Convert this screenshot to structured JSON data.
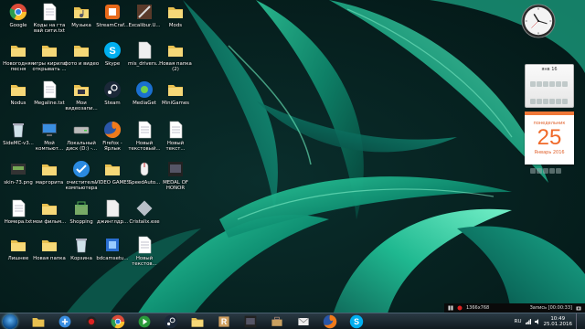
{
  "desktop": {
    "icons": [
      {
        "label": "Google",
        "icon": "chrome-icon"
      },
      {
        "label": "Коды на гта вай сити.txt",
        "icon": "text-file-icon"
      },
      {
        "label": "Музыка",
        "icon": "music-folder-icon"
      },
      {
        "label": "StreamCraf...",
        "icon": "streamcraft-icon"
      },
      {
        "label": "Excalibur.U...",
        "icon": "excalibur-icon"
      },
      {
        "label": "Mods",
        "icon": "folder-icon"
      },
      {
        "label": "Новогодняя песня",
        "icon": "folder-icon"
      },
      {
        "label": "игры кирила открывать ...",
        "icon": "folder-icon"
      },
      {
        "label": "фото и видео",
        "icon": "folder-icon"
      },
      {
        "label": "Skype",
        "icon": "skype-icon"
      },
      {
        "label": "mis_drivers...",
        "icon": "file-icon"
      },
      {
        "label": "Новая папка (2)",
        "icon": "folder-icon"
      },
      {
        "label": "Nodus",
        "icon": "folder-icon"
      },
      {
        "label": "Megaline.txt",
        "icon": "text-file-icon"
      },
      {
        "label": "Мои видеозапи...",
        "icon": "video-folder-icon"
      },
      {
        "label": "Steam",
        "icon": "steam-icon"
      },
      {
        "label": "MediaGet",
        "icon": "mediaget-icon"
      },
      {
        "label": "MiniGames",
        "icon": "folder-icon"
      },
      {
        "label": "SideMC-v3...",
        "icon": "recycle-bin-icon"
      },
      {
        "label": "Мой компьют...",
        "icon": "computer-icon"
      },
      {
        "label": "Локальный диск (D:) -...",
        "icon": "drive-icon"
      },
      {
        "label": "Firefox - Ярлык",
        "icon": "firefox-icon"
      },
      {
        "label": "Новый текстовый...",
        "icon": "text-file-icon"
      },
      {
        "label": "Новый текст...",
        "icon": "text-file-icon"
      },
      {
        "label": "skin-73.png",
        "icon": "image-file-icon"
      },
      {
        "label": "маргорита",
        "icon": "folder-icon"
      },
      {
        "label": "очиститель компьютера",
        "icon": "cleaner-icon"
      },
      {
        "label": "VIDEO GAMES",
        "icon": "folder-icon"
      },
      {
        "label": "SpeedAuto...",
        "icon": "mouse-icon"
      },
      {
        "label": "MEDAL OF HONOR",
        "icon": "game-icon"
      },
      {
        "label": "Номера.txt",
        "icon": "text-file-icon"
      },
      {
        "label": "мои фильм...",
        "icon": "folder-icon"
      },
      {
        "label": "Shopping",
        "icon": "shopping-icon"
      },
      {
        "label": "джинглдр...",
        "icon": "file-icon"
      },
      {
        "label": "Cristalix.exe",
        "icon": "cristalix-icon"
      },
      {
        "label": "Лишнее",
        "icon": "folder-icon"
      },
      {
        "label": "Новая папка",
        "icon": "folder-icon"
      },
      {
        "label": "Корзина",
        "icon": "recycle-bin-icon"
      },
      {
        "label": "bdcamsetu...",
        "icon": "installer-icon"
      },
      {
        "label": "Новый текстов...",
        "icon": "text-file-icon"
      }
    ]
  },
  "calendar": {
    "month_header": "янв 16",
    "weekday": "понедельник",
    "day": "25",
    "month_year": "Январь 2016"
  },
  "recorder": {
    "resolution": "1366x768",
    "status": "Запись [00:00:33]"
  },
  "taskbar": {
    "items": [
      "explorer-icon",
      "apps-icon",
      "record-icon",
      "chrome-icon",
      "media-center-icon",
      "steam-icon",
      "folder-icon",
      "roblox-icon",
      "game-icon",
      "toolbox-icon",
      "mail-icon",
      "firefox-icon",
      "skype-icon"
    ],
    "language": "RU",
    "time": "10:49",
    "date": "25.01.2016"
  },
  "colors": {
    "accent_orange": "#f06a2a",
    "taskbar_bg": "#1a2630",
    "wallpaper_green": "#16a07a"
  }
}
